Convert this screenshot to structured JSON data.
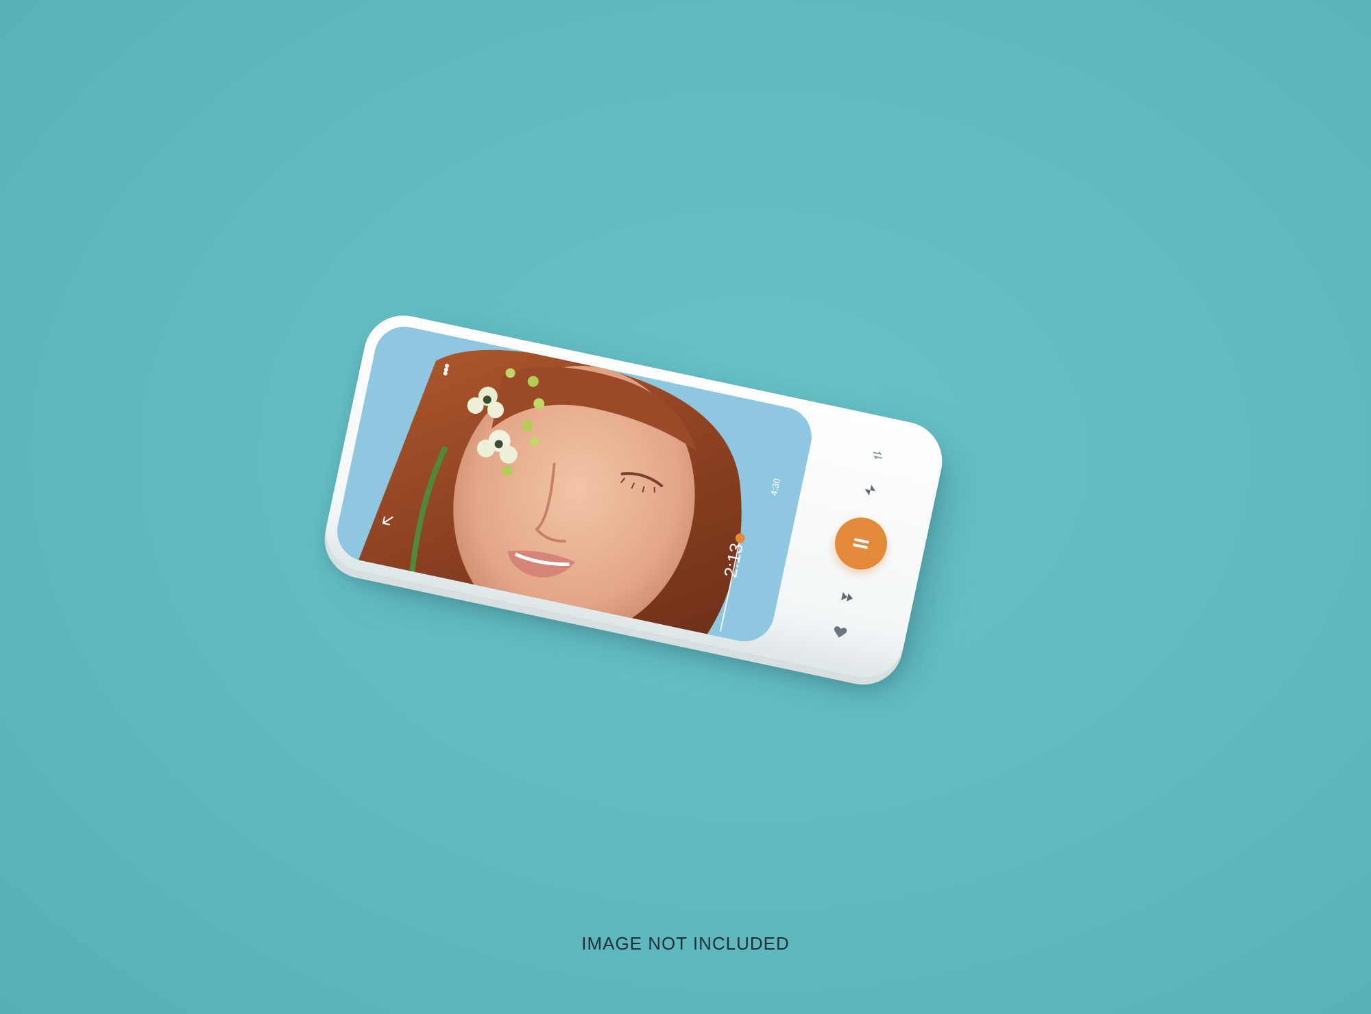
{
  "caption": "IMAGE NOT INCLUDED",
  "player": {
    "time_elapsed": "2:13",
    "time_total": "4:30",
    "progress": 0.49,
    "state": "playing"
  },
  "icons": {
    "menu": "more-vertical-icon",
    "back": "arrow-down-left-icon",
    "repeat": "repeat-icon",
    "previous": "skip-previous-icon",
    "play_pause": "pause-icon",
    "next": "skip-next-icon",
    "favorite": "heart-icon"
  },
  "colors": {
    "background": "#63bcc3",
    "accent": "#e38a3a",
    "phone_body": "#ffffff",
    "screen_sky": "#8fc7e0"
  }
}
